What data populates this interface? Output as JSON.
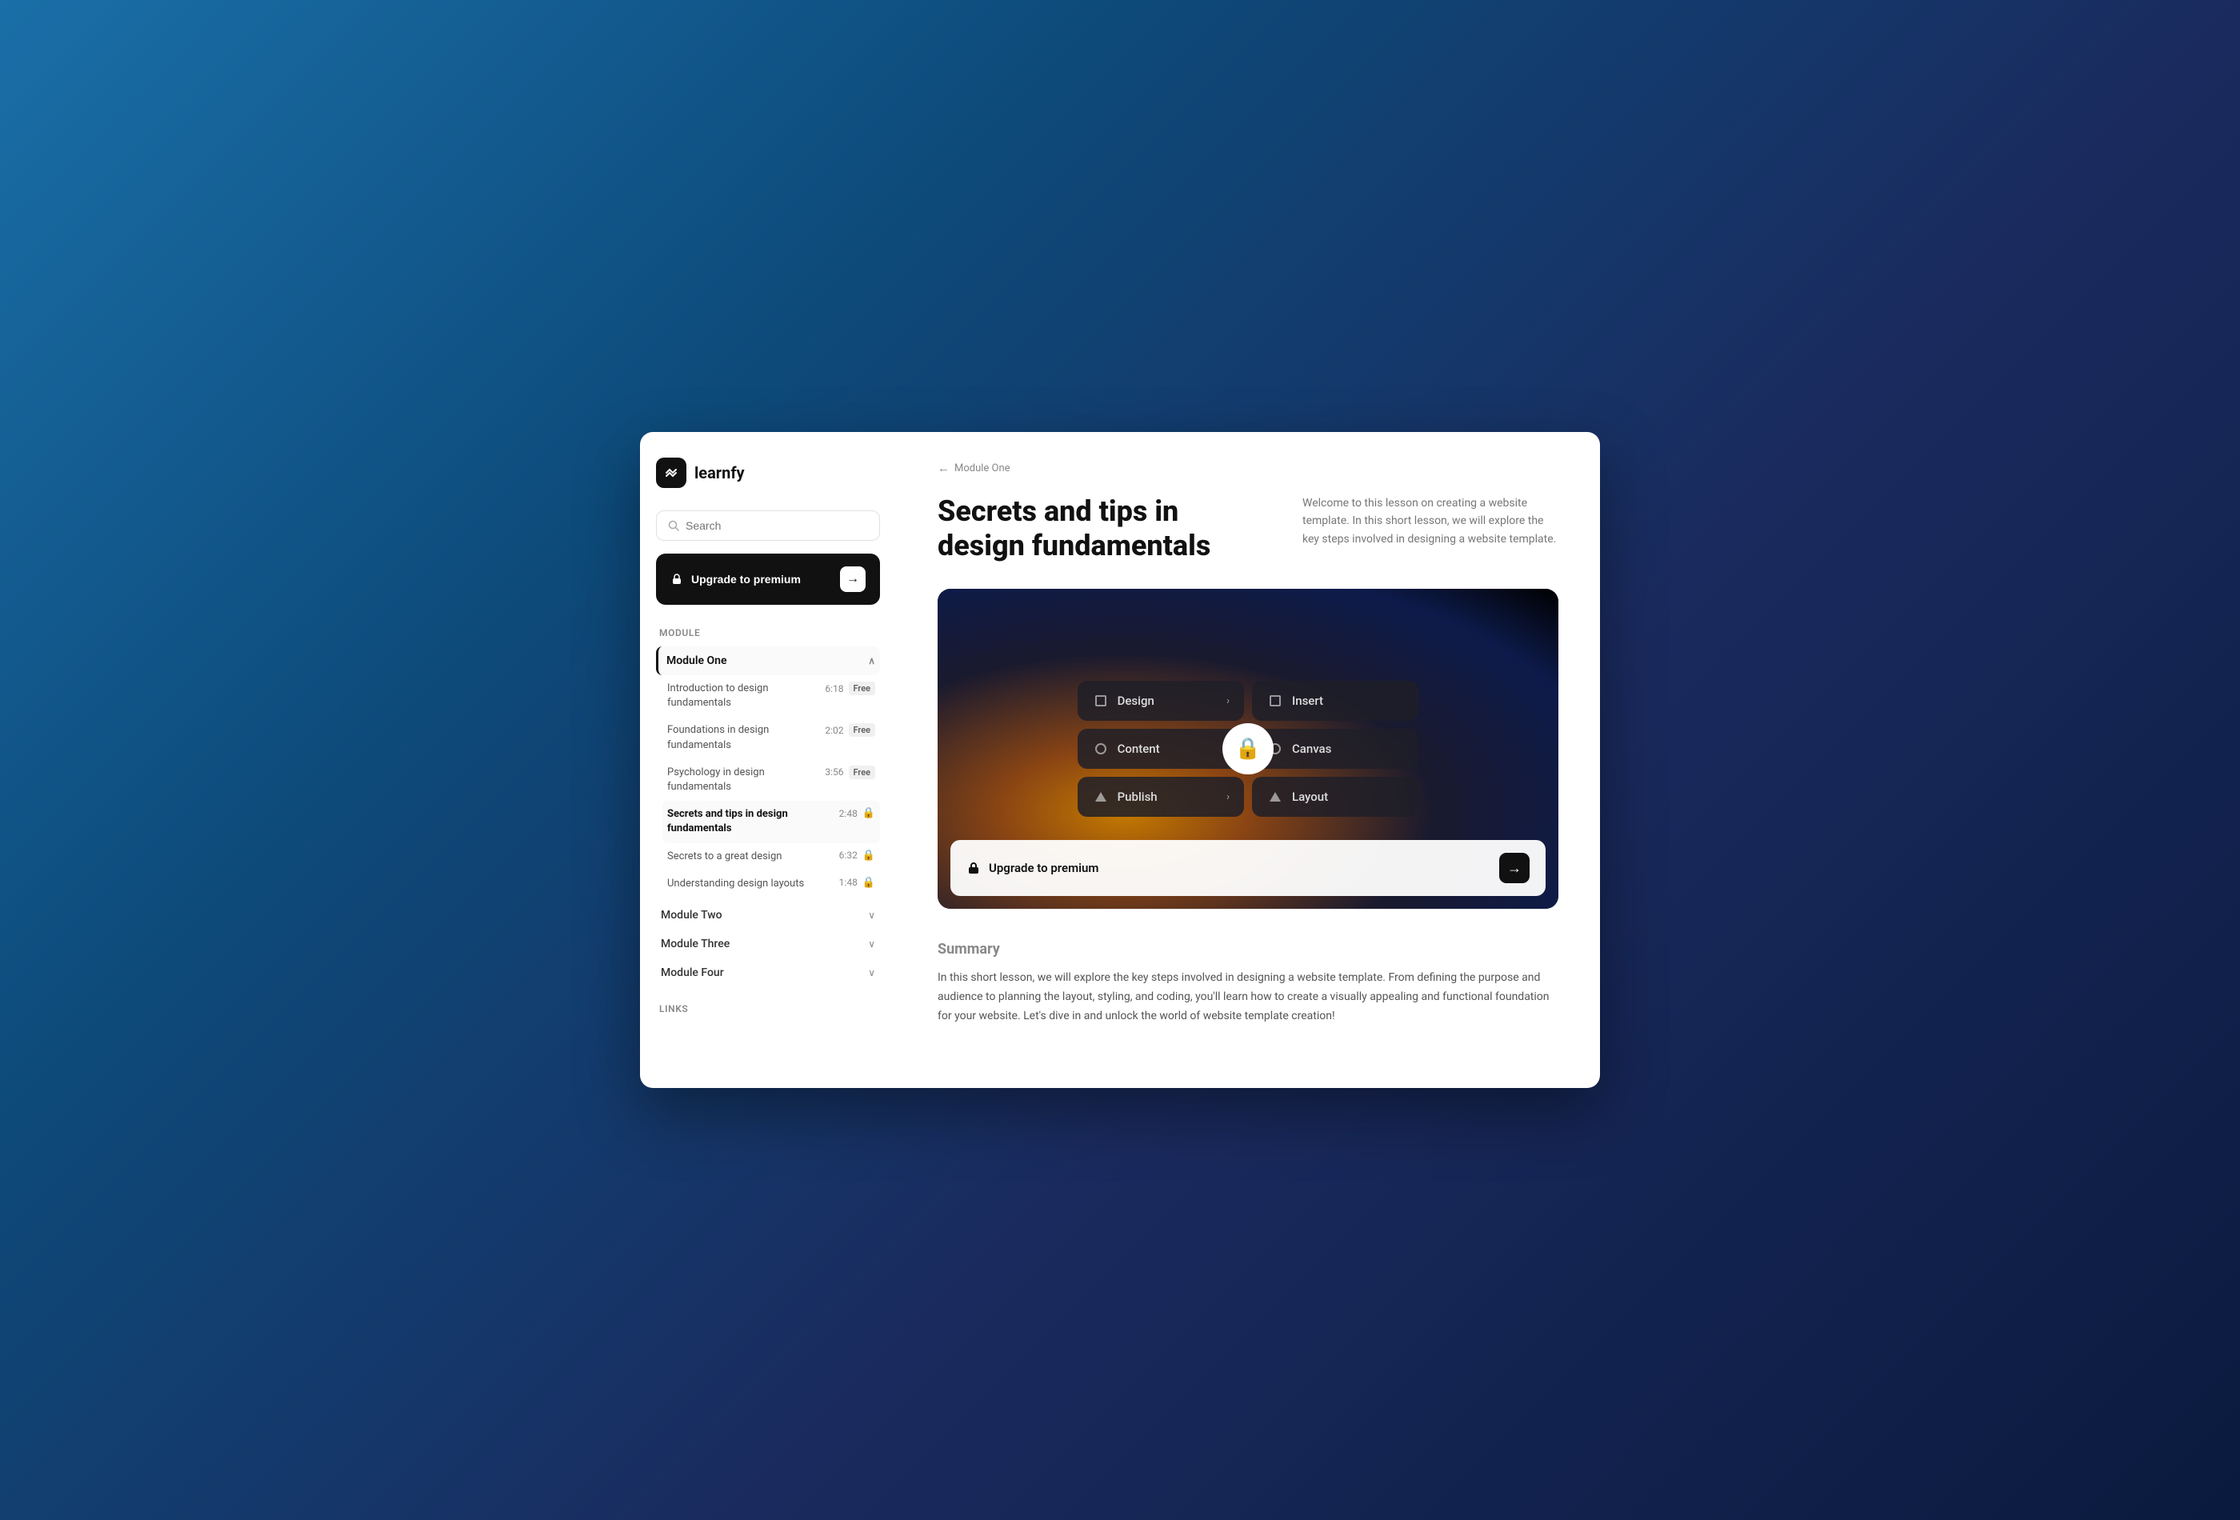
{
  "app": {
    "name": "learnfy",
    "logo_icon": "✦"
  },
  "sidebar": {
    "search_placeholder": "Search",
    "upgrade_label": "Upgrade to premium",
    "module_section_label": "Module",
    "modules": [
      {
        "id": "module-one",
        "label": "Module One",
        "expanded": true,
        "lessons": [
          {
            "title": "Introduction to design fundamentals",
            "duration": "6:18",
            "badge": "Free",
            "locked": false
          },
          {
            "title": "Foundations in design fundamentals",
            "duration": "2:02",
            "badge": "Free",
            "locked": false
          },
          {
            "title": "Psychology in design fundamentals",
            "duration": "3:56",
            "badge": "Free",
            "locked": false
          },
          {
            "title": "Secrets and tips in design fundamentals",
            "duration": "2:48",
            "badge": null,
            "locked": true,
            "active": true
          },
          {
            "title": "Secrets to a great design",
            "duration": "6:32",
            "badge": null,
            "locked": true
          },
          {
            "title": "Understanding design layouts",
            "duration": "1:48",
            "badge": null,
            "locked": true
          }
        ]
      },
      {
        "id": "module-two",
        "label": "Module Two",
        "expanded": false,
        "lessons": []
      },
      {
        "id": "module-three",
        "label": "Module Three",
        "expanded": false,
        "lessons": []
      },
      {
        "id": "module-four",
        "label": "Module Four",
        "expanded": false,
        "lessons": []
      }
    ],
    "links_label": "Links"
  },
  "main": {
    "breadcrumb": "Module One",
    "lesson_title": "Secrets and tips in design fundamentals",
    "lesson_description": "Welcome to this lesson on creating a website template. In this short lesson, we will explore the key steps involved in designing a website template.",
    "video": {
      "upgrade_label": "Upgrade to premium",
      "menu_items": [
        {
          "icon": "square",
          "label": "Design",
          "has_arrow": true
        },
        {
          "icon": "square",
          "label": "Insert",
          "has_arrow": false
        },
        {
          "icon": "circle",
          "label": "Content",
          "has_arrow": false
        },
        {
          "icon": "circle",
          "label": "Canvas",
          "has_arrow": false
        },
        {
          "icon": "triangle",
          "label": "Publish",
          "has_arrow": true
        },
        {
          "icon": "triangle",
          "label": "Layout",
          "has_arrow": false
        }
      ]
    },
    "summary": {
      "title": "Summary",
      "text": "In this short lesson, we will explore the key steps involved in designing a website template. From defining the purpose and audience to planning the layout, styling, and coding, you'll learn how to create a visually appealing and functional foundation for your website. Let's dive in and unlock the world of website template creation!"
    }
  }
}
